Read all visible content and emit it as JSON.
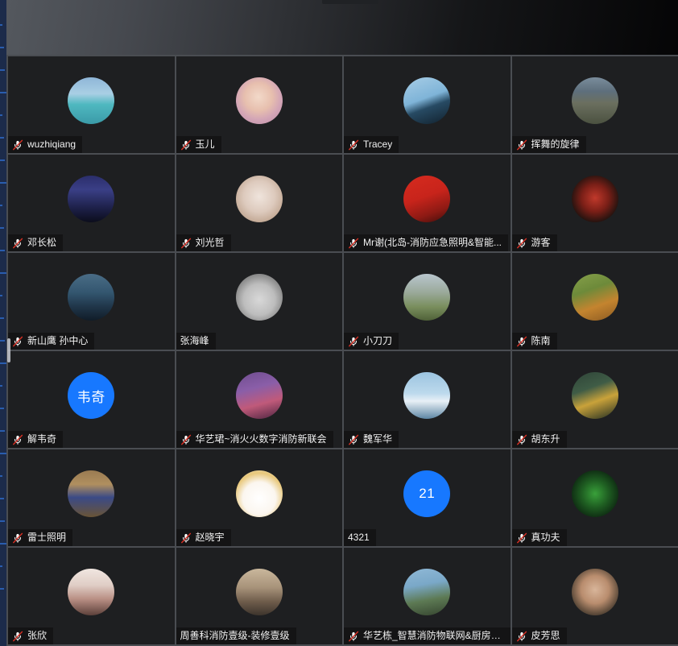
{
  "app": {
    "title": "Meeting Gallery View",
    "accent_blue": "#1778ff",
    "tile_bg": "#1e1f21",
    "grid_line": "#4a4d52",
    "nameplate_bg": "#141415",
    "mic_muted_slash": "#d93025"
  },
  "topbar": {
    "notch_label": ""
  },
  "scrollbar": {
    "position_label": ""
  },
  "grid": {
    "columns": 4,
    "rows": 6
  },
  "participants": [
    {
      "name": "wuzhiqiang",
      "muted": true,
      "avatar_kind": "photo",
      "avatar_style": "linear-gradient(180deg,#8fb6d8 0%,#a9cfe4 35%,#4fb8c0 58%,#3a9aa8 100%)"
    },
    {
      "name": "玉儿",
      "muted": true,
      "avatar_kind": "photo",
      "avatar_style": "radial-gradient(circle at 48% 42%, #f2d9c9 0%, #e7bfae 38%, #d3a5b6 62%, #b98aa6 100%)"
    },
    {
      "name": "Tracey",
      "muted": true,
      "avatar_kind": "photo",
      "avatar_style": "linear-gradient(160deg,#a7cde6 0%,#7fb4d8 45%,#274a63 62%,#11202c 100%)"
    },
    {
      "name": "挥舞的旋律",
      "muted": true,
      "avatar_kind": "photo",
      "avatar_style": "linear-gradient(180deg,#7a8d9c 0%,#5e6f7c 30%,#6b6f5f 55%,#4b5140 100%)"
    },
    {
      "name": "邓长松",
      "muted": true,
      "avatar_kind": "photo",
      "avatar_style": "linear-gradient(180deg,#2b2e6b 0%,#3a3f86 30%,#1d2048 70%,#0c0d1c 100%)"
    },
    {
      "name": "刘光哲",
      "muted": true,
      "avatar_kind": "photo",
      "avatar_style": "radial-gradient(circle at 50% 45%, #efe4dc 0%, #ddcabd 45%, #c2a894 75%, #6b5a4c 100%)"
    },
    {
      "name": "Mr谢(北岛-消防应急照明&智能...",
      "muted": true,
      "avatar_kind": "photo",
      "avatar_style": "linear-gradient(160deg,#d62b1f 0%,#c8241b 45%,#8e1a14 75%,#3e0d0a 100%)"
    },
    {
      "name": "游客",
      "muted": true,
      "avatar_kind": "photo",
      "avatar_style": "radial-gradient(circle at 50% 48%, #c0392b 0%, #7b1f17 40%, #2a1410 70%, #0d0708 100%)"
    },
    {
      "name": "新山鹰 孙中心",
      "muted": true,
      "avatar_kind": "photo",
      "avatar_style": "linear-gradient(180deg,#4a6c86 0%,#33566f 40%,#20364a 70%,#101c28 100%)"
    },
    {
      "name": "张海峰",
      "muted": false,
      "avatar_kind": "photo",
      "avatar_style": "radial-gradient(circle at 50% 55%, #d8d8d8 0%, #bdbdbd 45%, #8c8c8c 70%, #6f6f6f 100%)"
    },
    {
      "name": "小刀刀",
      "muted": true,
      "avatar_kind": "photo",
      "avatar_style": "linear-gradient(180deg,#b9c6ce 0%,#9aa99a 40%,#7a8f5e 70%,#4f6138 100%)"
    },
    {
      "name": "陈南",
      "muted": true,
      "avatar_kind": "photo",
      "avatar_style": "linear-gradient(160deg,#86a04a 0%,#6d8a3a 35%,#c4842f 65%,#8a5a22 100%)"
    },
    {
      "name": "解韦奇",
      "muted": true,
      "avatar_kind": "text",
      "avatar_text": "韦奇"
    },
    {
      "name": "华艺珺~消火火数字消防新联会",
      "muted": true,
      "avatar_kind": "photo",
      "avatar_style": "linear-gradient(165deg,#6f4d8f 0%,#8a5ea8 35%,#c05a7a 65%,#4a2440 100%)"
    },
    {
      "name": "魏军华",
      "muted": true,
      "avatar_kind": "photo",
      "avatar_style": "linear-gradient(180deg,#9cc4e0 0%,#bcd9ec 45%,#e8f0f6 62%,#5d86a4 100%)"
    },
    {
      "name": "胡东升",
      "muted": true,
      "avatar_kind": "photo",
      "avatar_style": "linear-gradient(160deg,#2f4438 0%,#3f5c46 35%,#c9a23a 60%,#1d2b22 100%)"
    },
    {
      "name": "雷士照明",
      "muted": true,
      "avatar_kind": "photo",
      "avatar_style": "linear-gradient(180deg,#9a7b52 0%,#b08f5f 30%,#3a4a86 58%,#6a5436 100%)"
    },
    {
      "name": "赵晓宇",
      "muted": true,
      "avatar_kind": "photo",
      "avatar_style": "radial-gradient(circle at 50% 60%, #ffffff 0%, #fbf6ef 45%, #e8c77a 70%, #f2ead8 100%)"
    },
    {
      "name": "4321",
      "muted": false,
      "avatar_kind": "text",
      "avatar_text": "21"
    },
    {
      "name": "真功夫",
      "muted": true,
      "avatar_kind": "photo",
      "avatar_style": "radial-gradient(circle at 50% 50%, #39a03a 0%, #1f5f22 40%, #0e2a12 75%, #050d06 100%)"
    },
    {
      "name": "张欣",
      "muted": true,
      "avatar_kind": "photo",
      "avatar_style": "linear-gradient(180deg,#f0e6e0 0%,#e0cec6 35%,#b98f84 65%,#5c403a 100%)"
    },
    {
      "name": "周善科消防壹级-装修壹级",
      "muted": false,
      "avatar_kind": "photo",
      "avatar_style": "linear-gradient(180deg,#c9b79c 0%,#a8937a 40%,#6f5d4c 70%,#3d342c 100%)"
    },
    {
      "name": "华艺栋_智慧消防物联网&厨房灭...",
      "muted": true,
      "avatar_kind": "photo",
      "avatar_style": "linear-gradient(170deg,#8fb8d6 0%,#7aa8c8 35%,#5d7a54 65%,#35442f 100%)"
    },
    {
      "name": "皮芳思",
      "muted": true,
      "avatar_kind": "photo",
      "avatar_style": "radial-gradient(circle at 50% 45%, #d8b59a 0%, #b98d6e 40%, #5c4a3a 70%, #24201c 100%)"
    }
  ]
}
